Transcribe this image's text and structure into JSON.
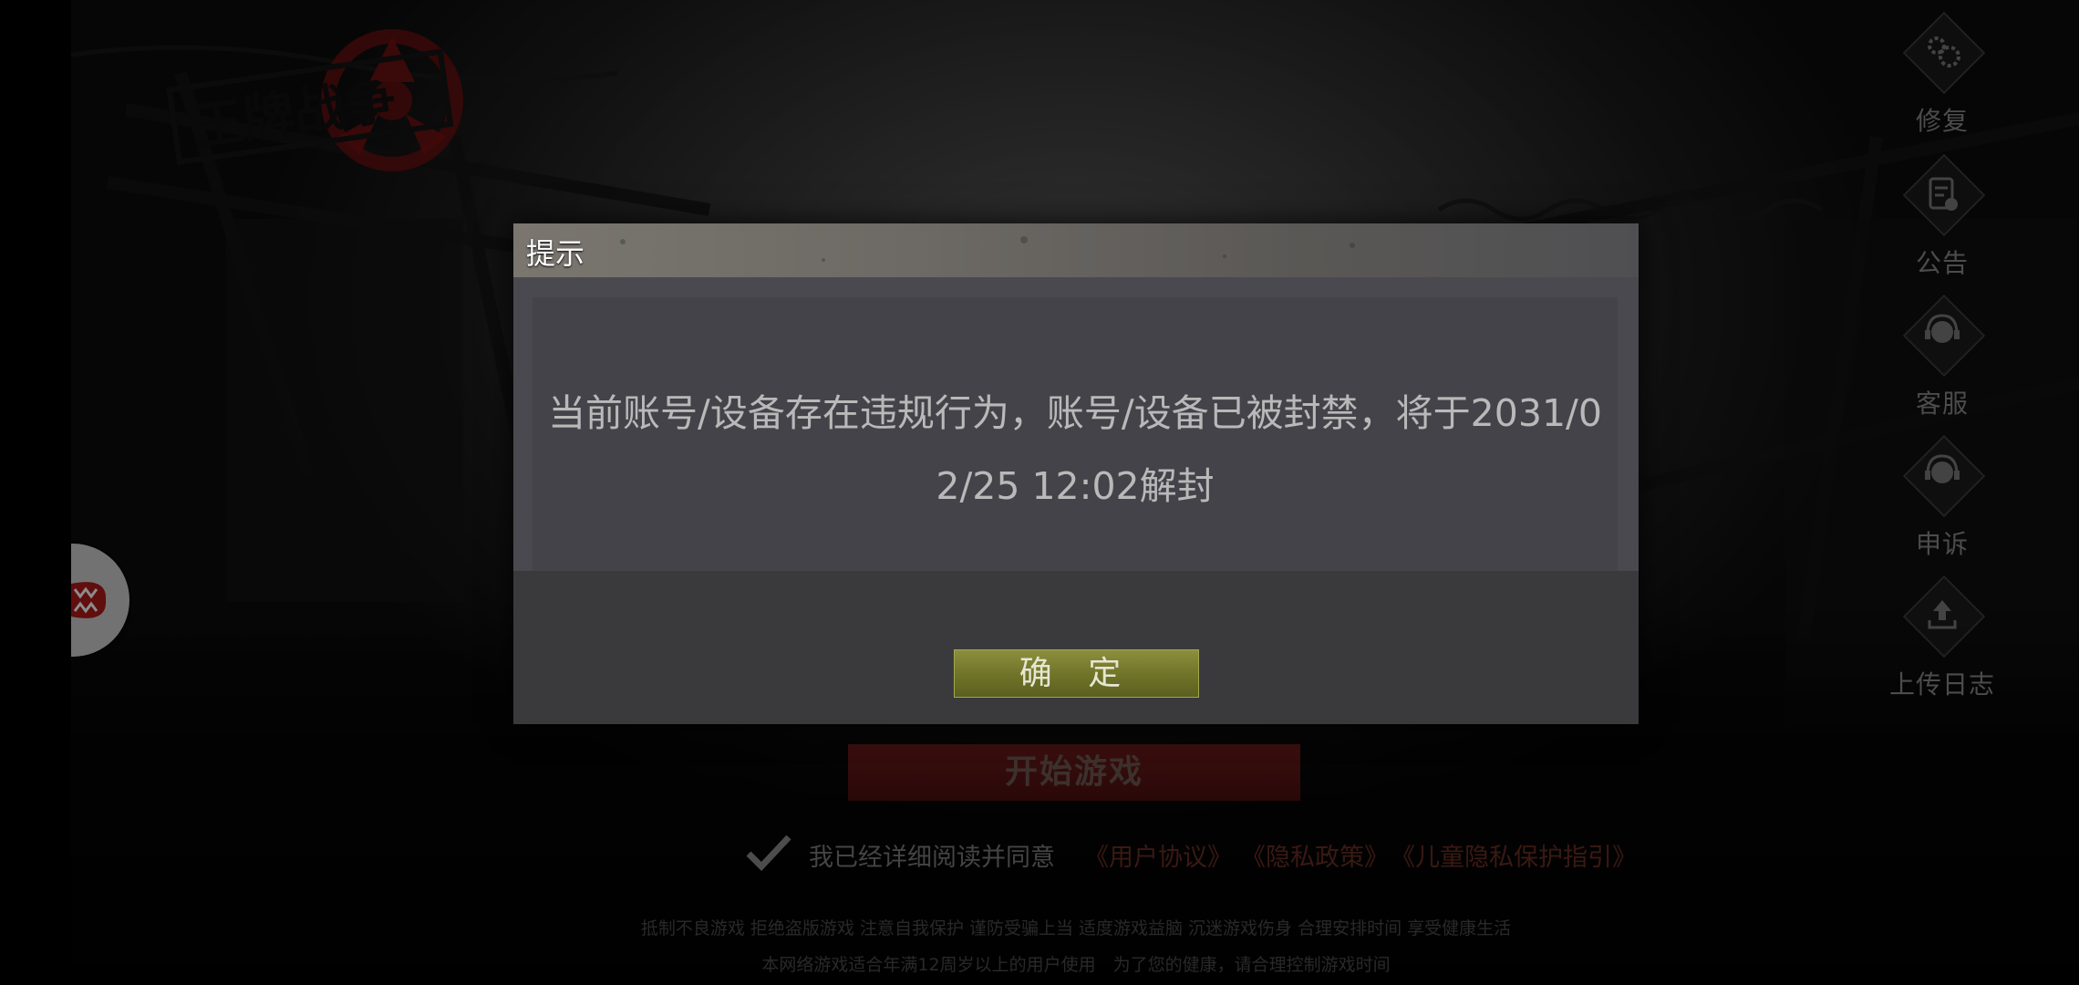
{
  "dialog": {
    "title": "提示",
    "message": "当前账号/设备存在违规行为，账号/设备已被封禁，将于2031/02/25 12:02解封",
    "confirm_label": "确 定"
  },
  "side_menu": [
    {
      "label": "修复",
      "icon": "gears-icon"
    },
    {
      "label": "公告",
      "icon": "clipboard-icon"
    },
    {
      "label": "客服",
      "icon": "headset-icon"
    },
    {
      "label": "申诉",
      "icon": "headset-icon"
    },
    {
      "label": "上传日志",
      "icon": "upload-icon"
    }
  ],
  "start_button_label": "开始游戏",
  "agreement": {
    "text": "我已经详细阅读并同意",
    "links": [
      "《用户协议》",
      "《隐私政策》",
      "《儿童隐私保护指引》"
    ]
  },
  "footer": {
    "line1": "抵制不良游戏 拒绝盗版游戏 注意自我保护 谨防受骗上当 适度游戏益脑 沉迷游戏伤身 合理安排时间 享受健康生活",
    "line2": "本网络游戏适合年满12周岁以上的用户使用　为了您的健康，请合理控制游戏时间"
  },
  "colors": {
    "confirm_button": "#6e7328",
    "start_button": "#4d1010",
    "link": "#6b2e24"
  }
}
